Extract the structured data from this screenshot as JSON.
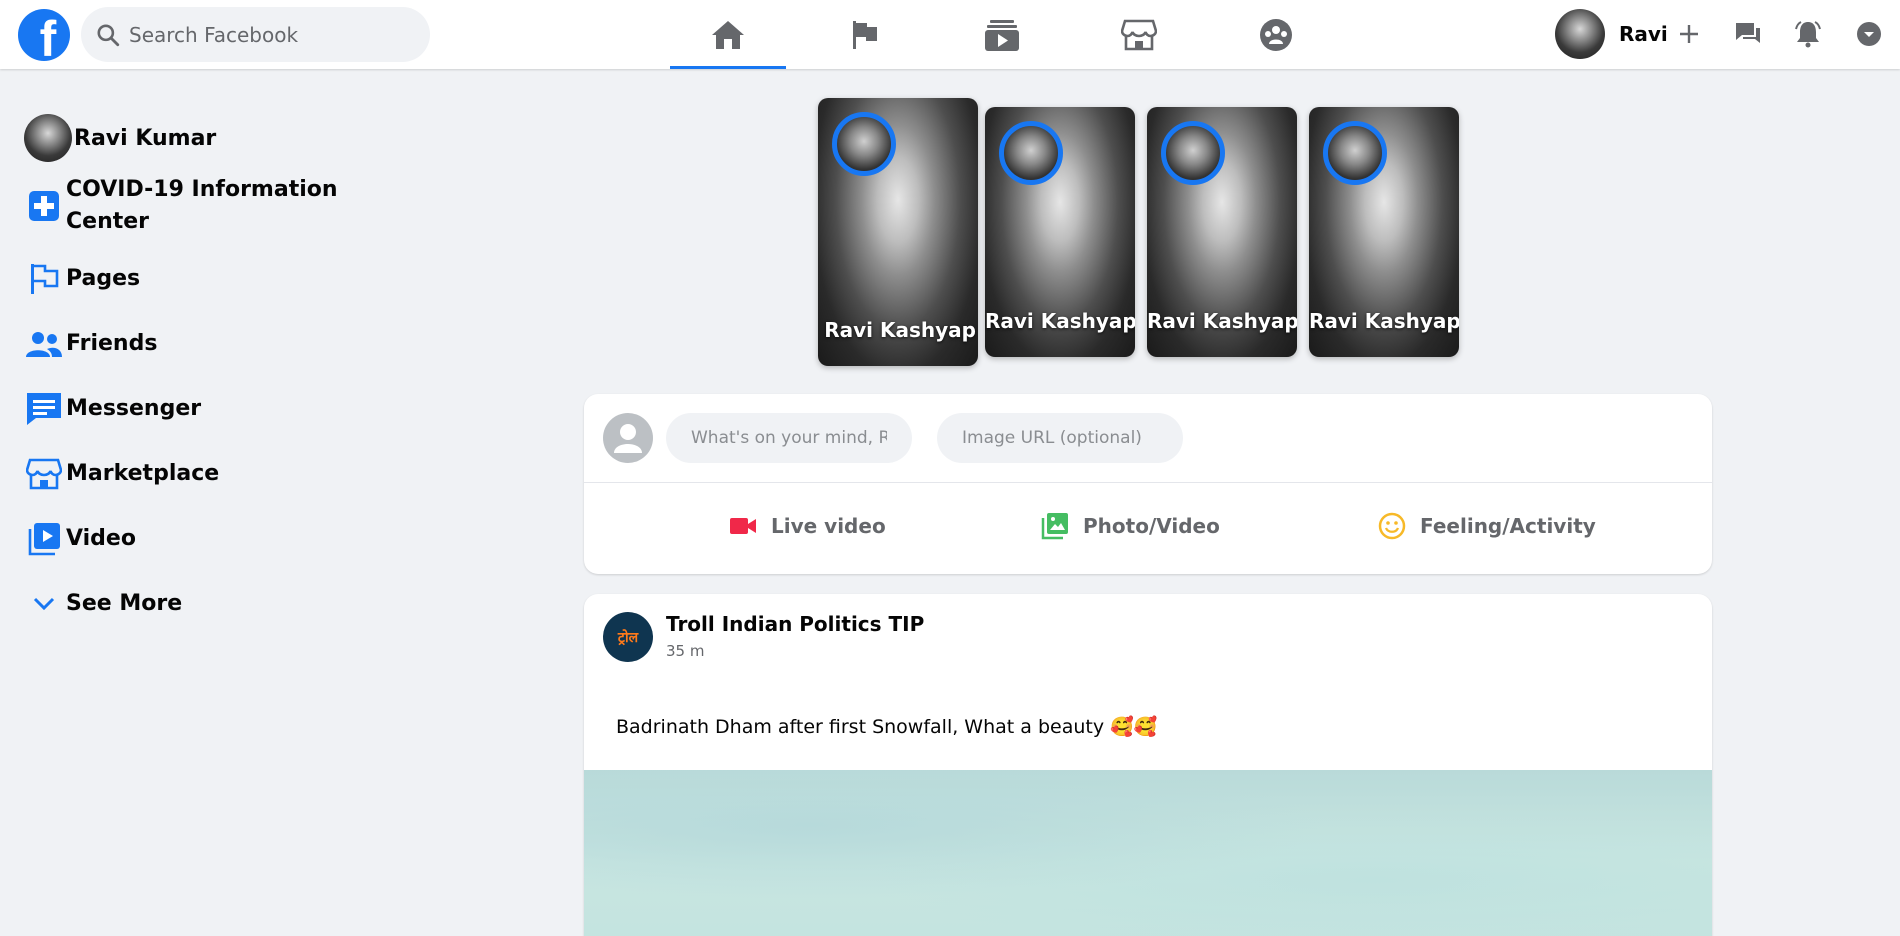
{
  "header": {
    "logo_letter": "f",
    "search_placeholder": "Search Facebook",
    "nav_tabs": [
      "home-icon",
      "flag-icon",
      "watch-icon",
      "marketplace-icon",
      "groups-icon"
    ],
    "profile_name": "Ravi"
  },
  "sidebar": {
    "user_name": "Ravi Kumar",
    "items": [
      {
        "label": "COVID-19 Information Center",
        "icon": "covid-info-icon"
      },
      {
        "label": "Pages",
        "icon": "flag-icon"
      },
      {
        "label": "Friends",
        "icon": "friends-icon"
      },
      {
        "label": "Messenger",
        "icon": "messenger-icon"
      },
      {
        "label": "Marketplace",
        "icon": "marketplace-icon"
      },
      {
        "label": "Video",
        "icon": "video-icon"
      }
    ],
    "see_more": "See More"
  },
  "stories": [
    {
      "name": "Ravi Kashyap"
    },
    {
      "name": "Ravi Kashyap"
    },
    {
      "name": "Ravi Kashyap"
    },
    {
      "name": "Ravi Kashyap"
    }
  ],
  "composer": {
    "status_placeholder": "What's on your mind, Ravi?",
    "image_placeholder": "Image URL (optional)",
    "actions": [
      "Live video",
      "Photo/Video",
      "Feeling/Activity"
    ]
  },
  "post": {
    "author": "Troll Indian Politics TIP",
    "avatar_text": "ट्रोल",
    "time": "35 m",
    "text": "Badrinath Dham after first Snowfall, What a beauty 🥰🥰"
  },
  "colors": {
    "brand": "#1877f2",
    "live": "#f02849",
    "photo": "#45bd62",
    "feeling": "#f7b928"
  }
}
